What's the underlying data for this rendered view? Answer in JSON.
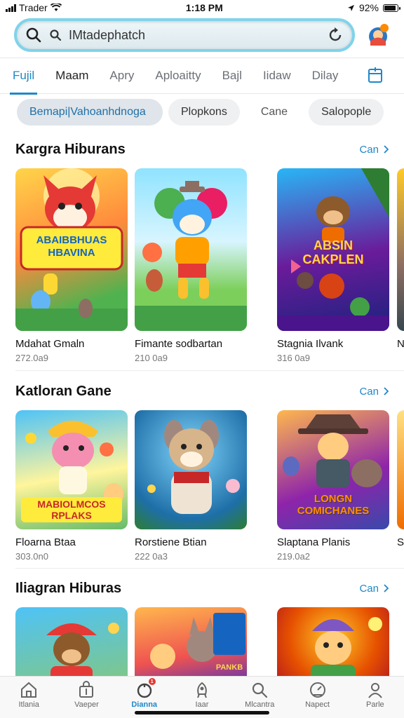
{
  "status_bar": {
    "carrier": "Trader",
    "time": "1:18 PM",
    "battery": "92%"
  },
  "search": {
    "value": "IMtadephatch",
    "placeholder": "IMtadephatch"
  },
  "tabs": [
    {
      "label": "Fujil",
      "active": true
    },
    {
      "label": "Maam",
      "active": false
    },
    {
      "label": "Apry",
      "active": false
    },
    {
      "label": "Aploaitty",
      "active": false
    },
    {
      "label": "Bajl",
      "active": false
    },
    {
      "label": "Iidaw",
      "active": false
    },
    {
      "label": "Dilay",
      "active": false
    }
  ],
  "chips": [
    {
      "label": "Bemapi|Vahoanhdnoga",
      "selected": true
    },
    {
      "label": "Plopkons",
      "selected": false
    },
    {
      "label": "Cane",
      "selected": false
    },
    {
      "label": "Salopople",
      "selected": false
    }
  ],
  "sections": [
    {
      "title": "Kargra Hiburans",
      "see_all": "Can",
      "cards": [
        {
          "title": "Mdahat Gmaln",
          "meta": "272.0a9",
          "art": "ABAIBBHUAS HBAVINA"
        },
        {
          "title": "Fimante sodbartan",
          "meta": "210 0a9",
          "art": ""
        },
        {
          "title": "Stagnia Ilvank",
          "meta": "316 0a9",
          "art": "ABSIN CAKPLEN"
        },
        {
          "title": "N",
          "meta": "",
          "art": ""
        }
      ]
    },
    {
      "title": "Katloran Gane",
      "see_all": "Can",
      "cards": [
        {
          "title": "Floarna Btaa",
          "meta": "303.0n0",
          "art": "MABIOLMCOS RPLAKS"
        },
        {
          "title": "Rorstiene Btian",
          "meta": "222 0a3",
          "art": ""
        },
        {
          "title": "Slaptana Planis",
          "meta": "219.0a2",
          "art": "LONGN COMICHANES"
        },
        {
          "title": "S",
          "meta": "",
          "art": ""
        }
      ]
    },
    {
      "title": "Iliagran  Hiburas",
      "see_all": "Can",
      "cards": [
        {
          "title": "",
          "meta": "",
          "art": ""
        },
        {
          "title": "",
          "meta": "",
          "art": "PANKB"
        },
        {
          "title": "",
          "meta": "",
          "art": ""
        }
      ]
    }
  ],
  "bottom_nav": [
    {
      "label": "Itlania",
      "icon": "home-icon",
      "active": false
    },
    {
      "label": "Vaeper",
      "icon": "bag-icon",
      "active": false
    },
    {
      "label": "Dianna",
      "icon": "games-icon",
      "active": true,
      "badge": "1"
    },
    {
      "label": "Iaar",
      "icon": "rocket-icon",
      "active": false
    },
    {
      "label": "Mlcantra",
      "icon": "search-icon",
      "active": false
    },
    {
      "label": "Napect",
      "icon": "speed-icon",
      "active": false
    },
    {
      "label": "Parle",
      "icon": "person-icon",
      "active": false
    }
  ],
  "colors": {
    "accent": "#1e88c8",
    "search_border": "#7fd3ea"
  }
}
